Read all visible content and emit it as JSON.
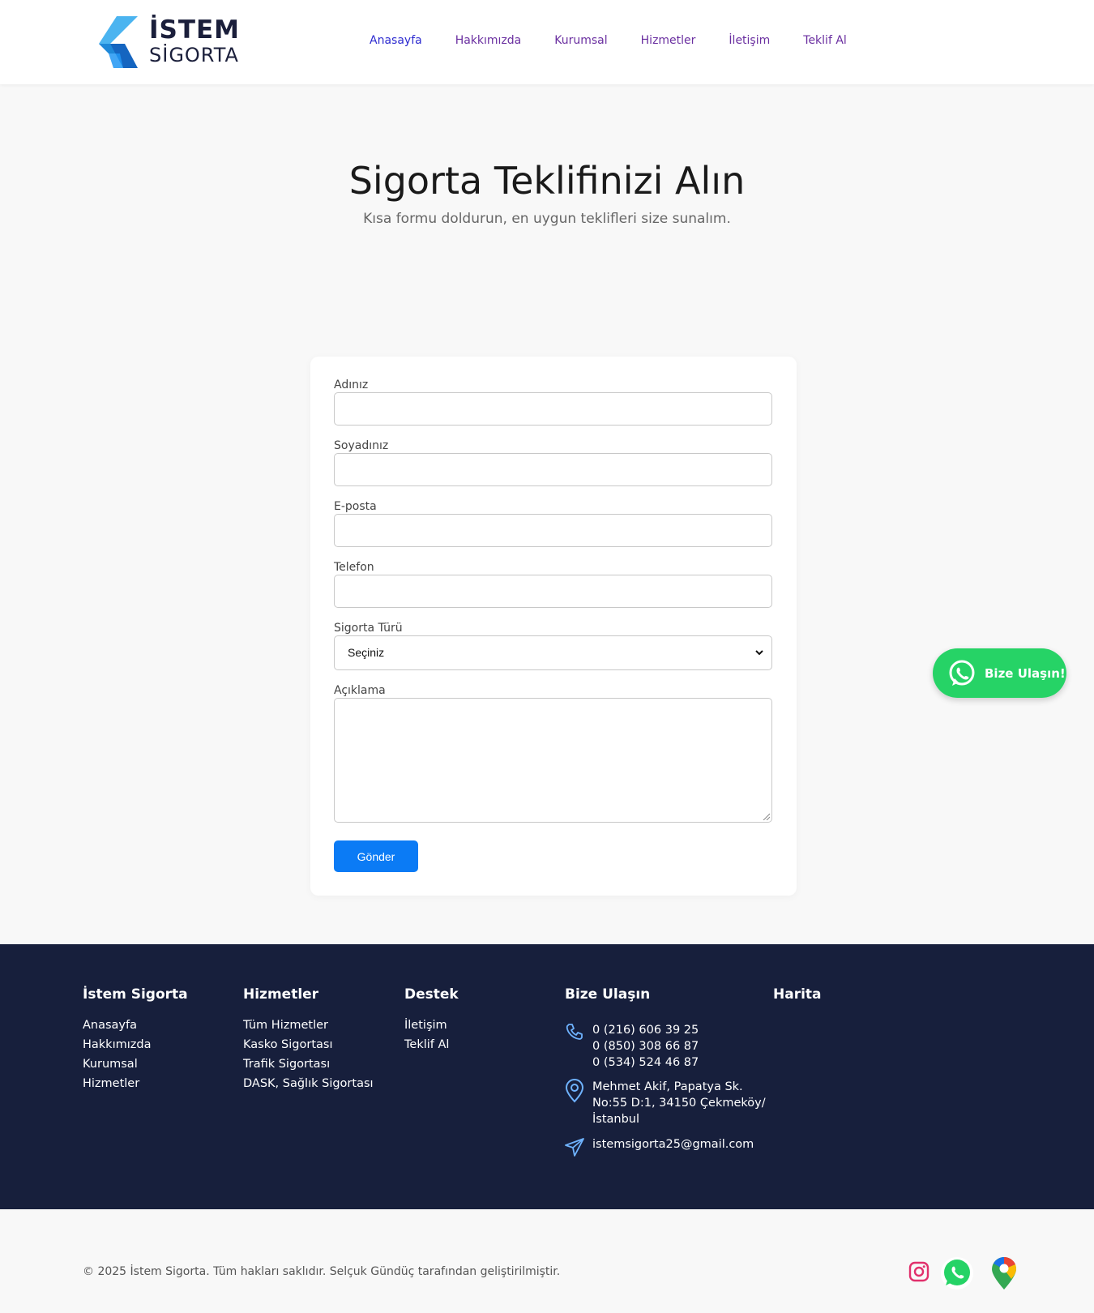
{
  "header": {
    "logo_line1": "İSTEM",
    "logo_line2": "SİGORTA",
    "nav": [
      "Anasayfa",
      "Hakkımızda",
      "Kurumsal",
      "Hizmetler",
      "İletişim",
      "Teklif Al"
    ]
  },
  "hero": {
    "title": "Sigorta Teklifinizi Alın",
    "subtitle": "Kısa formu doldurun, en uygun teklifleri size sunalım."
  },
  "form": {
    "first_name_label": "Adınız",
    "first_name_value": "",
    "last_name_label": "Soyadınız",
    "last_name_value": "",
    "email_label": "E-posta",
    "email_value": "",
    "phone_label": "Telefon",
    "phone_value": "",
    "insurance_type_label": "Sigorta Türü",
    "insurance_type_selected": "Seçiniz",
    "description_label": "Açıklama",
    "description_value": "",
    "submit_label": "Gönder"
  },
  "whatsapp_float": {
    "label": "Bize Ulaşın!"
  },
  "footer": {
    "col1": {
      "title": "İstem Sigorta",
      "links": [
        "Anasayfa",
        "Hakkımızda",
        "Kurumsal",
        "Hizmetler"
      ]
    },
    "col2": {
      "title": "Hizmetler",
      "links": [
        "Tüm Hizmetler",
        "Kasko Sigortası",
        "Trafik Sigortası",
        "DASK, Sağlık Sigortası"
      ]
    },
    "col3": {
      "title": "Destek",
      "links": [
        "İletişim",
        "Teklif Al"
      ]
    },
    "contact": {
      "title": "Bize Ulaşın",
      "phones": [
        "0 (216) 606 39 25",
        "0 (850) 308 66 87",
        "0 (534) 524 46 87"
      ],
      "address": [
        "Mehmet Akif, Papatya Sk.",
        "No:55 D:1, 34150 Çekmeköy/",
        "İstanbul"
      ],
      "email": "istemsigorta25@gmail.com"
    },
    "map": {
      "title": "Harita"
    }
  },
  "bottom": {
    "copyright": "© 2025 İstem Sigorta. Tüm hakları saklıdır. Selçuk Gündüç tarafından geliştirilmiştir.",
    "social_icons": [
      "instagram-icon",
      "whatsapp-icon",
      "google-maps-icon"
    ]
  },
  "colors": {
    "nav_link": "#6a2fa0",
    "nav_active": "#2d2bd0",
    "submit_button": "#0b7bf5",
    "whatsapp": "#26d366",
    "footer_bg": "#171f3c",
    "logo_blue": "#29a3ea"
  }
}
